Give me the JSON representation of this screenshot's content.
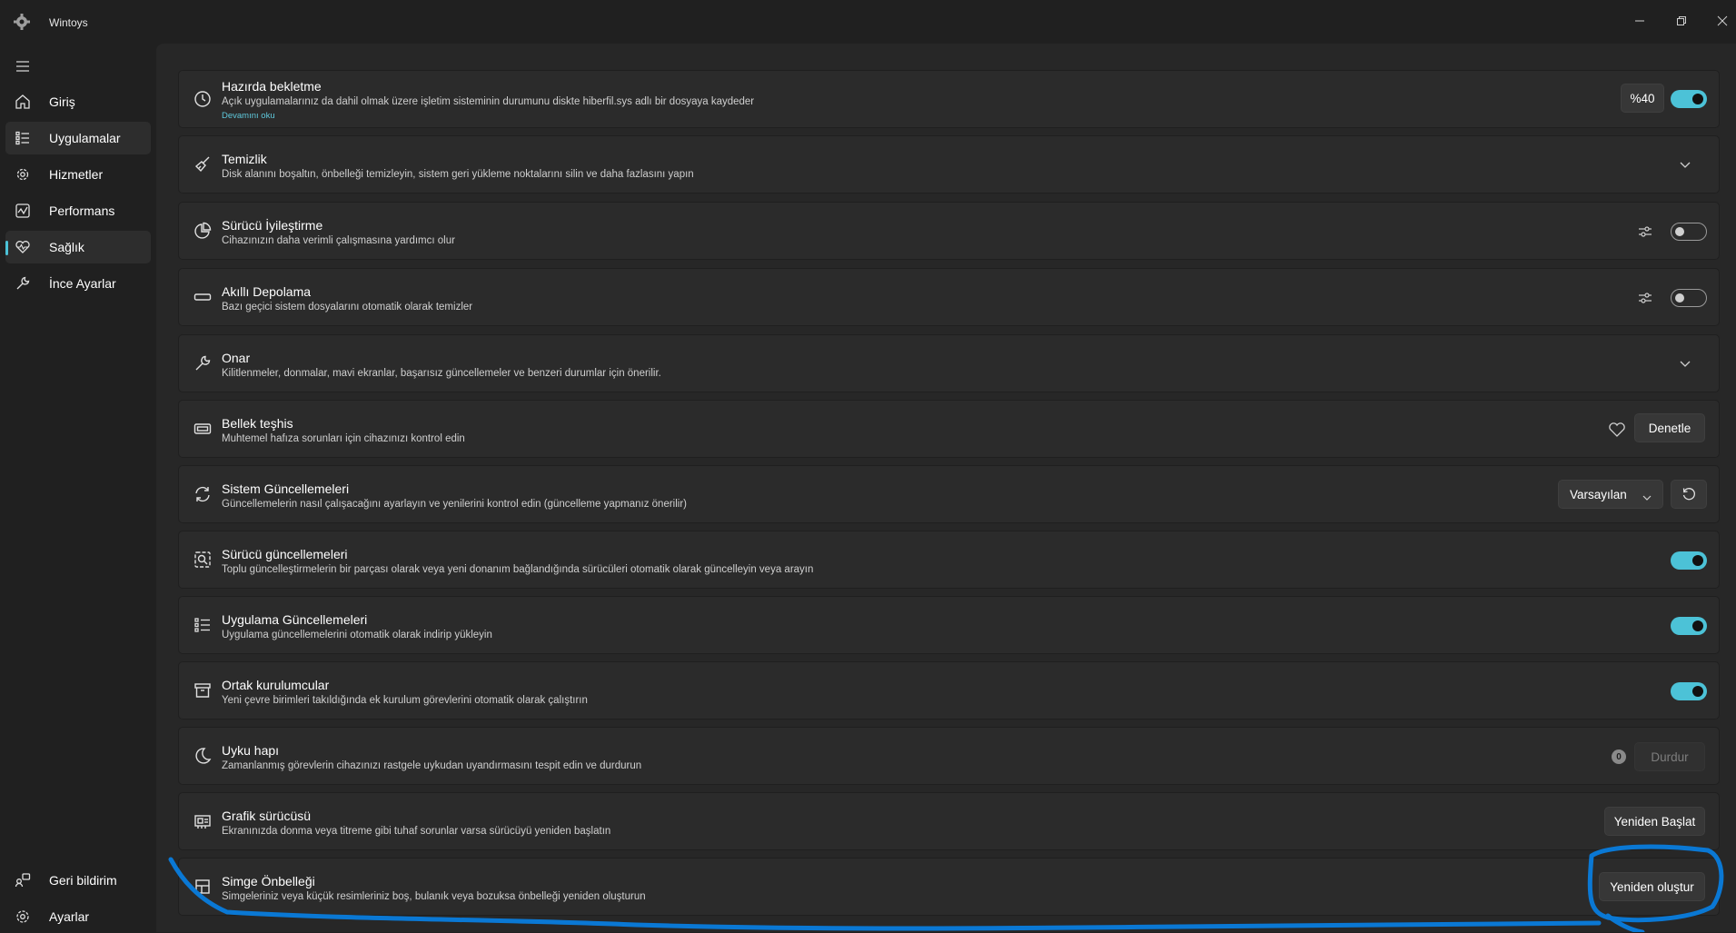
{
  "window": {
    "title": "Wintoys",
    "controls": {
      "minimize_icon": "minimize-icon",
      "restore_icon": "restore-icon",
      "close_icon": "close-icon"
    }
  },
  "sidebar": {
    "menu_icon": "hamburger-icon",
    "items": [
      {
        "label": "Giriş",
        "icon": "home-icon",
        "selected": false
      },
      {
        "label": "Uygulamalar",
        "icon": "apps-list-icon",
        "selected": true
      },
      {
        "label": "Hizmetler",
        "icon": "gear-services-icon",
        "selected": false
      },
      {
        "label": "Performans",
        "icon": "performance-icon",
        "selected": false
      },
      {
        "label": "Sağlık",
        "icon": "health-heart-icon",
        "selected": true,
        "active": true
      },
      {
        "label": "İnce Ayarlar",
        "icon": "wrench-icon",
        "selected": false
      }
    ],
    "footer": [
      {
        "label": "Geri bildirim",
        "icon": "feedback-icon"
      },
      {
        "label": "Ayarlar",
        "icon": "settings-icon"
      }
    ]
  },
  "cards": [
    {
      "title": "Hazırda bekletme",
      "description": "Açık uygulamalarınız da dahil olmak üzere işletim sisteminin durumunu diskte hiberfil.sys adlı bir dosyaya kaydeder",
      "link": "Devamını oku",
      "icon": "clock-icon",
      "percent_label": "%40",
      "toggle": true
    },
    {
      "title": "Temizlik",
      "description": "Disk alanını boşaltın, önbelleği temizleyin, sistem geri yükleme noktalarını silin ve daha fazlasını yapın",
      "icon": "broom-icon",
      "expand_icon": "chevron-down-icon"
    },
    {
      "title": "Sürücü İyileştirme",
      "description": "Cihazınızın daha verimli çalışmasına yardımcı olur",
      "icon": "pie-chart-icon",
      "settings_icon": "sliders-icon",
      "toggle": false
    },
    {
      "title": "Akıllı Depolama",
      "description": "Bazı geçici sistem dosyalarını otomatik olarak temizler",
      "icon": "drive-icon",
      "settings_icon": "sliders-icon",
      "toggle": false
    },
    {
      "title": "Onar",
      "description": "Kilitlenmeler, donmalar, mavi ekranlar, başarısız güncellemeler ve benzeri durumlar için önerilir.",
      "icon": "wrench-icon",
      "expand_icon": "chevron-down-icon"
    },
    {
      "title": "Bellek teşhis",
      "description": "Muhtemel hafıza sorunları için cihazınızı kontrol edin",
      "icon": "memory-icon",
      "heart_icon": "heart-icon",
      "button": "Denetle"
    },
    {
      "title": "Sistem Güncellemeleri",
      "description": "Güncellemelerin nasıl çalışacağını ayarlayın ve yenilerini kontrol edin (güncelleme yapmanız önerilir)",
      "icon": "sync-icon",
      "dropdown": "Varsayılan",
      "refresh_icon": "refresh-icon"
    },
    {
      "title": "Sürücü güncellemeleri",
      "description": "Toplu güncelleştirmelerin bir parçası olarak veya yeni donanım bağlandığında sürücüleri otomatik olarak güncelleyin veya arayın",
      "icon": "driver-search-icon",
      "toggle": true
    },
    {
      "title": "Uygulama Güncellemeleri",
      "description": "Uygulama güncellemelerini otomatik olarak indirip yükleyin",
      "icon": "apps-list-icon",
      "toggle": true
    },
    {
      "title": "Ortak kurulumcular",
      "description": "Yeni çevre birimleri takıldığında ek kurulum görevlerini otomatik olarak çalıştırın",
      "icon": "box-icon",
      "toggle": true
    },
    {
      "title": "Uyku hapı",
      "description": "Zamanlanmış görevlerin cihazınızı rastgele uykudan uyandırmasını tespit edin ve durdurun",
      "icon": "moon-icon",
      "count": "0",
      "button": "Durdur",
      "button_disabled": true
    },
    {
      "title": "Grafik sürücüsü",
      "description": "Ekranınızda donma veya titreme gibi tuhaf sorunlar varsa sürücüyü yeniden başlatın",
      "icon": "gpu-icon",
      "button": "Yeniden Başlat"
    },
    {
      "title": "Simge Önbelleği",
      "description": "Simgeleriniz veya küçük resimleriniz boş, bulanık veya bozuksa önbelleği yeniden oluşturun",
      "icon": "icon-grid-icon",
      "button": "Yeniden oluştur"
    }
  ],
  "colors": {
    "accent": "#4cc2d7",
    "background": "#202020",
    "card": "#2b2b2b",
    "annotation": "#0a78d4"
  }
}
